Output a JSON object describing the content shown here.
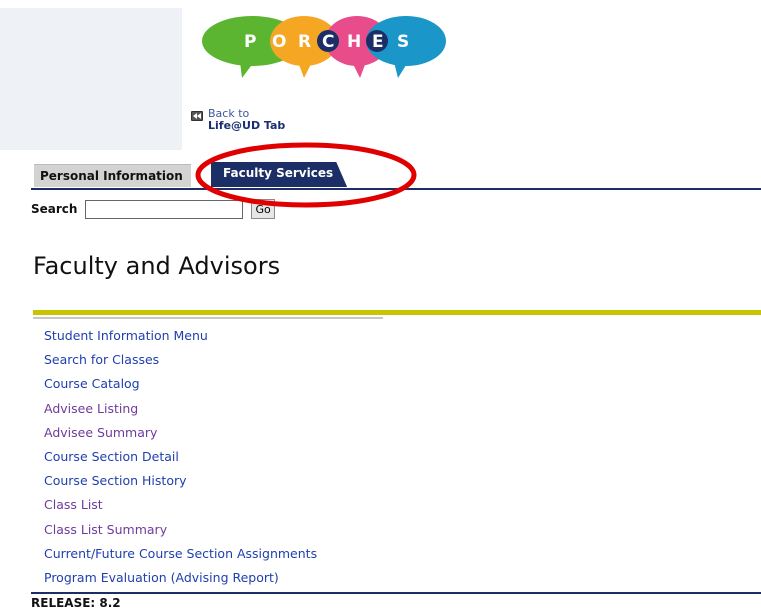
{
  "header": {
    "logo_letters": [
      "P",
      "O",
      "R",
      "C",
      "H",
      "E",
      "S"
    ],
    "back_link_line1": "Back to",
    "back_link_line2": "Life@UD Tab",
    "back_icon": "double-arrow-left-icon"
  },
  "tabs": [
    {
      "label": "Personal Information",
      "active": false
    },
    {
      "label": "Faculty Services",
      "active": true
    }
  ],
  "search": {
    "label": "Search",
    "value": "",
    "button_label": "Go"
  },
  "page": {
    "title": "Faculty and Advisors"
  },
  "menu": {
    "items": [
      {
        "label": "Student Information Menu",
        "color": "blue"
      },
      {
        "label": "Search for Classes",
        "color": "blue"
      },
      {
        "label": "Course Catalog",
        "color": "blue"
      },
      {
        "label": "Advisee Listing",
        "color": "purple"
      },
      {
        "label": "Advisee Summary",
        "color": "purple"
      },
      {
        "label": "Course Section Detail",
        "color": "blue"
      },
      {
        "label": "Course Section History",
        "color": "blue"
      },
      {
        "label": "Class List",
        "color": "purple"
      },
      {
        "label": "Class List Summary",
        "color": "purple"
      },
      {
        "label": "Current/Future Course Section Assignments",
        "color": "blue"
      },
      {
        "label": "Program Evaluation (Advising Report)",
        "color": "blue"
      }
    ]
  },
  "footer": {
    "release": "RELEASE: 8.2"
  },
  "colors": {
    "brand_navy": "#1b2f66",
    "accent_olive": "#c8c400",
    "link_blue": "#1f3fae",
    "link_visited": "#6f3a9b",
    "annotation_red": "#e00000",
    "bubble_green": "#5cb531",
    "bubble_orange": "#f5a623",
    "bubble_pink": "#e84c8b",
    "bubble_blue": "#1a96c8"
  }
}
